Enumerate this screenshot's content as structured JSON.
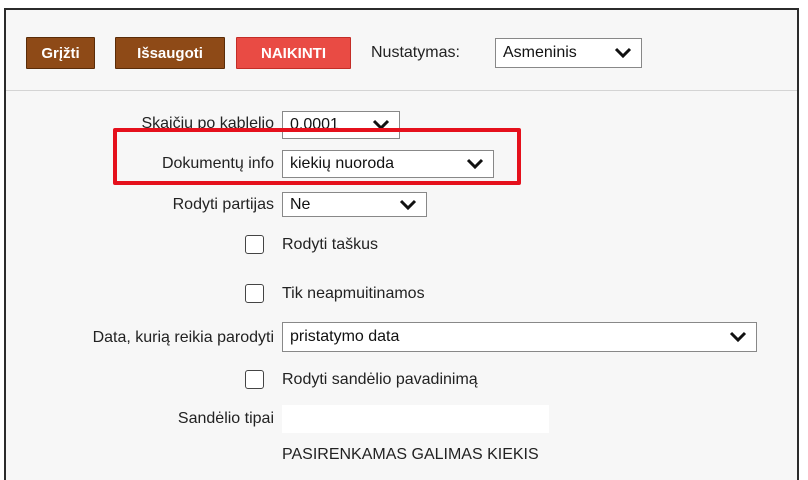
{
  "toolbar": {
    "back_label": "Grįžti",
    "save_label": "Išsaugoti",
    "delete_label": "NAIKINTI",
    "settings_label": "Nustatymas:",
    "settings_value": "Asmeninis"
  },
  "form": {
    "decimals_label": "Skaičių po kablelio",
    "decimals_value": "0.0001",
    "doc_info_label": "Dokumentų info",
    "doc_info_value": "kiekių nuoroda",
    "show_batches_label": "Rodyti partijas",
    "show_batches_value": "Ne",
    "show_points_label": "Rodyti taškus",
    "only_nonduty_label": "Tik neapmuitinamos",
    "date_label": "Data, kurią reikia parodyti",
    "date_value": "pristatymo data",
    "show_warehouse_name_label": "Rodyti sandėlio pavadinimą",
    "warehouse_types_label": "Sandėlio tipai",
    "warehouse_types_value": "",
    "footer_text": "PASIRENKAMAS GALIMAS KIEKIS"
  },
  "colors": {
    "brown_button": "#8e4a17",
    "red_button": "#e94b44",
    "highlight": "#e5101c"
  }
}
